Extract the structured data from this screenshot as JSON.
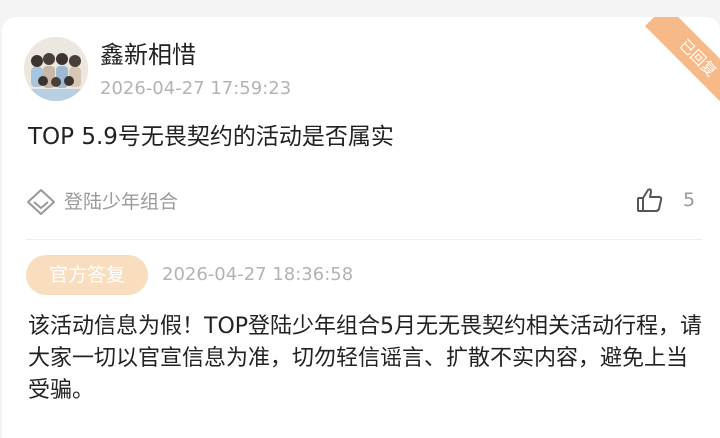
{
  "post": {
    "username": "鑫新相惜",
    "timestamp": "2026-04-27 17:59:23",
    "content": "TOP 5.9号无畏契约的活动是否属实",
    "topic": {
      "icon": "diamond-badge-icon",
      "label": "登陆少年组合"
    },
    "likes": {
      "icon": "thumbs-up-icon",
      "count": "5"
    },
    "status_ribbon": "已回复"
  },
  "reply": {
    "badge": "官方答复",
    "timestamp": "2026-04-27 18:36:58",
    "content": "该活动信息为假！TOP登陆少年组合5月无无畏契约相关活动行程，请大家一切以官宣信息为准，切勿轻信谣言、扩散不实内容，避免上当受骗。"
  },
  "colors": {
    "badge_bg": "#f8ddbf",
    "ribbon_bg": "#f7b987",
    "text": "#222222",
    "muted": "#b3b3b3"
  }
}
